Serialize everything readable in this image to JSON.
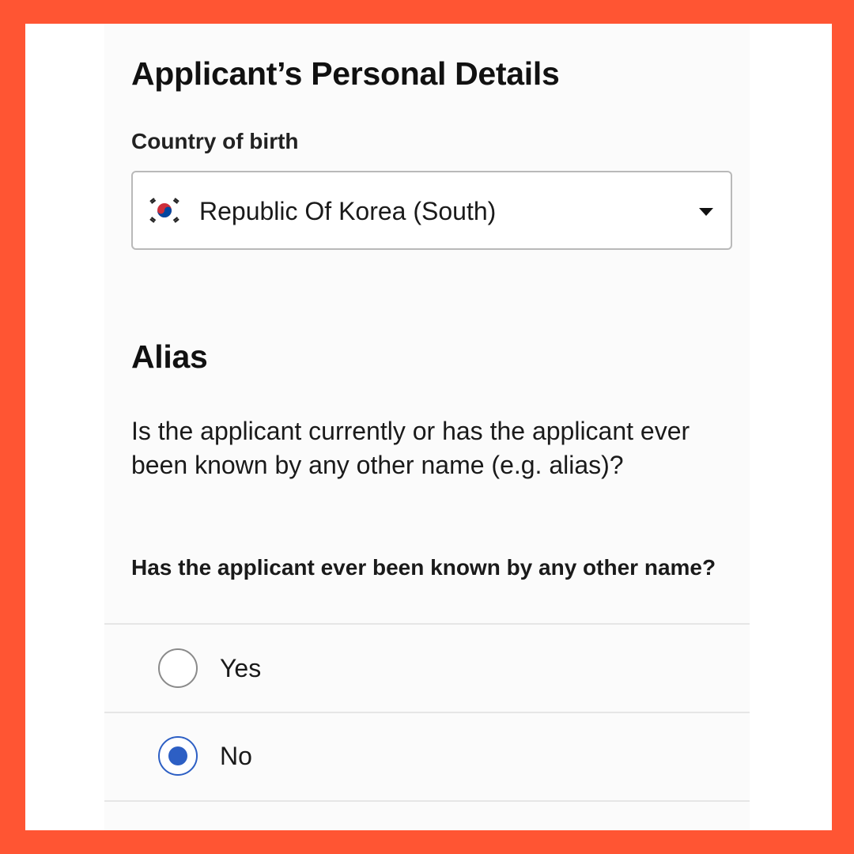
{
  "personal_details": {
    "heading": "Applicant’s Personal Details",
    "country_label": "Country of birth",
    "country_value": "Republic Of Korea (South)",
    "country_flag_icon": "south-korea-flag-icon"
  },
  "alias": {
    "heading": "Alias",
    "question": "Is the applicant currently or has the applicant ever been known by any other name (e.g. alias)?",
    "radio_legend": "Has the applicant ever been known by any other name?",
    "options": [
      {
        "label": "Yes",
        "selected": false
      },
      {
        "label": "No",
        "selected": true
      }
    ]
  },
  "colors": {
    "border_accent": "#ff5533",
    "radio_selected": "#2d5fc4"
  }
}
